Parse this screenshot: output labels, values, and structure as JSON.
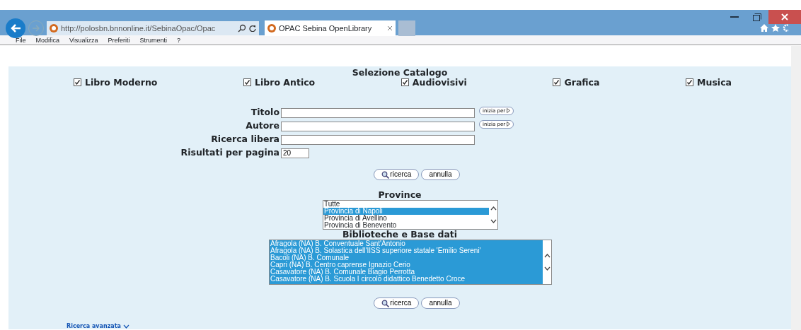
{
  "browser": {
    "url": "http://polosbn.bnnonline.it/SebinaOpac/Opac",
    "tab_title": "OPAC Sebina OpenLibrary",
    "menu": [
      "File",
      "Modifica",
      "Visualizza",
      "Preferiti",
      "Strumenti",
      "?"
    ]
  },
  "catalog": {
    "title": "Selezione Catalogo",
    "items": [
      {
        "label": "Libro Moderno",
        "checked": true
      },
      {
        "label": "Libro Antico",
        "checked": true
      },
      {
        "label": "Audiovisivi",
        "checked": true
      },
      {
        "label": "Grafica",
        "checked": true
      },
      {
        "label": "Musica",
        "checked": true
      }
    ]
  },
  "fields": [
    {
      "label": "Titolo",
      "kind": "text",
      "button": "inizia per"
    },
    {
      "label": "Autore",
      "kind": "text",
      "button": "inizia per"
    },
    {
      "label": "Ricerca libera",
      "kind": "text"
    },
    {
      "label": "Risultati per pagina",
      "kind": "small",
      "value": "20"
    }
  ],
  "actions_top": [
    "ricerca",
    "annulla"
  ],
  "province": {
    "title": "Province",
    "options": [
      {
        "label": "Tutte",
        "selected": false
      },
      {
        "label": "Provincia di Napoli",
        "selected": true
      },
      {
        "label": "Provincia di Avellino",
        "selected": false
      },
      {
        "label": "Provincia di Benevento",
        "selected": false
      }
    ]
  },
  "libraries": {
    "title": "Biblioteche e Base dati",
    "options": [
      {
        "label": "Afragola (NA) B. Conventuale Sant'Antonio",
        "selected": true
      },
      {
        "label": "Afragola (NA) B. Solastica dell'IISS superiore statale 'Emilio Sereni'",
        "selected": true
      },
      {
        "label": "Bacoli (NA) B. Comunale",
        "selected": true
      },
      {
        "label": "Capri (NA) B. Centro caprense Ignazio Cerio",
        "selected": true
      },
      {
        "label": "Casavatore (NA) B. Comunale Biagio Perrotta",
        "selected": true
      },
      {
        "label": "Casavatore (NA) B. Scuola I circolo didattico Benedetto Croce",
        "selected": true
      }
    ]
  },
  "actions_bottom": [
    "ricerca",
    "annulla"
  ],
  "advanced_link": "Ricerca avanzata"
}
